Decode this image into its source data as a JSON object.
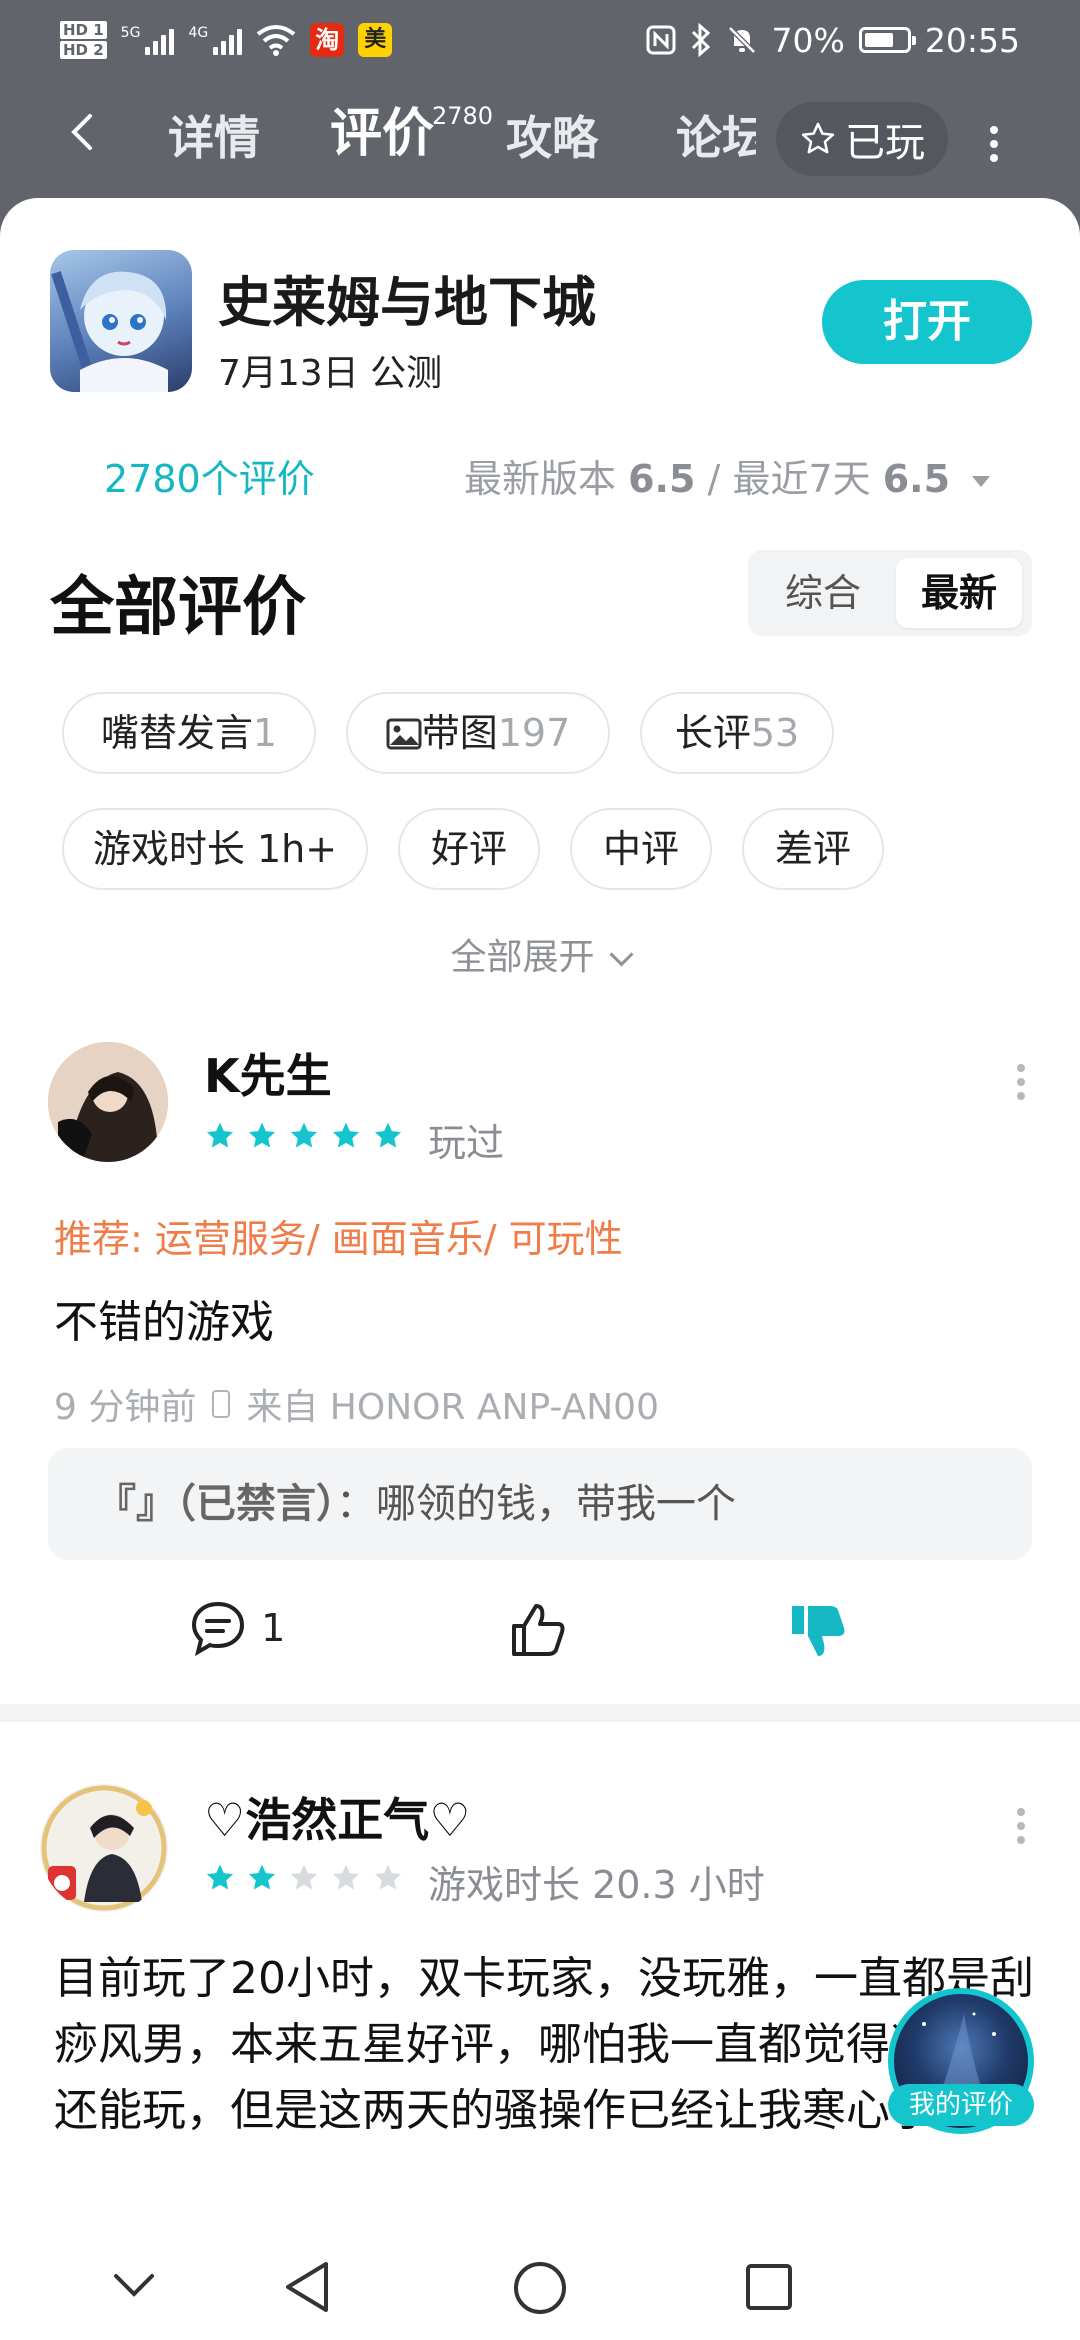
{
  "status_bar": {
    "hd1": "HD 1",
    "hd2": "HD 2",
    "net1": "5G",
    "net2": "4G",
    "app1_icon": "taobao-icon",
    "app1_text": "淘",
    "app2_icon": "meituan-icon",
    "app2_text": "美",
    "battery_percent": "70%",
    "battery_level": 0.7,
    "time": "20:55"
  },
  "nav": {
    "tabs": [
      {
        "label": "详情"
      },
      {
        "label": "评价",
        "badge": "2780"
      },
      {
        "label": "攻略"
      },
      {
        "label": "论坛"
      }
    ],
    "active_tab": "评价",
    "played_label": "已玩"
  },
  "game": {
    "title": "史莱姆与地下城",
    "date": "7月13日",
    "status": "公测",
    "open_label": "打开"
  },
  "ratings": {
    "count_label": "2780个评价",
    "latest_version_label": "最新版本",
    "latest_version_score": "6.5",
    "separator": "/",
    "recent_label": "最近7天",
    "recent_score": "6.5"
  },
  "section": {
    "title": "全部评价",
    "sort_options": [
      "综合",
      "最新"
    ],
    "sort_selected": "最新"
  },
  "filters": [
    {
      "label": "嘴替发言",
      "count": "1"
    },
    {
      "label": "带图",
      "count": "197",
      "icon": "image-icon"
    },
    {
      "label": "长评",
      "count": "53"
    },
    {
      "label": "游戏时长 1h+",
      "count": ""
    },
    {
      "label": "好评",
      "count": ""
    },
    {
      "label": "中评",
      "count": ""
    },
    {
      "label": "差评",
      "count": ""
    }
  ],
  "expand_label": "全部展开",
  "reviews": [
    {
      "user": "K先生",
      "stars": 5,
      "tag": "玩过",
      "recommend": "推荐: 运营服务/ 画面音乐/ 可玩性",
      "text": "不错的游戏",
      "time": "9 分钟前",
      "device": "来自 HONOR ANP-AN00",
      "reply_name": "『』（已禁言）",
      "reply_text": "：哪领的钱，带我一个",
      "comment_count": "1"
    },
    {
      "user": "♡浩然正气♡",
      "stars": 2,
      "tag": "游戏时长 20.3 小时",
      "text": "目前玩了20小时，双卡玩家，没玩雅，一直都是刮痧风男，本来五星好评，哪怕我一直都觉得这游戏还能玩，但是这两天的骚操作已经让我寒心了。"
    }
  ],
  "my_review_label": "我的评价",
  "colors": {
    "accent": "#15c5ce",
    "recommend": "#f07c4a",
    "header_bg": "#61656b"
  }
}
